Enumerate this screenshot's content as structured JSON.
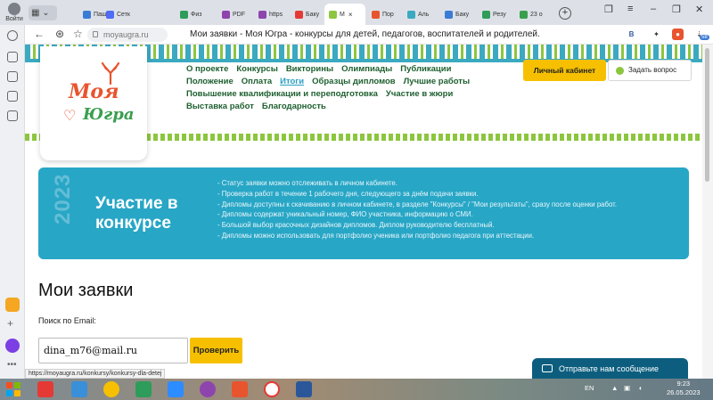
{
  "browser": {
    "profile_label": "Войти",
    "tabs": [
      {
        "label": "Паш",
        "color": "#3a7bd5"
      },
      {
        "label": "Сетк",
        "color": "#4e6cf5"
      },
      {
        "label": "Физ",
        "color": "#2e9c5a"
      },
      {
        "label": "PDF",
        "color": "#8e44ad"
      },
      {
        "label": "https",
        "color": "#8e44ad"
      },
      {
        "label": "Баку",
        "color": "#e53935"
      },
      {
        "label": "М",
        "color": "#8cc63f"
      },
      {
        "label": "Пор",
        "color": "#e8542e"
      },
      {
        "label": "Аль",
        "color": "#3ba9c0"
      },
      {
        "label": "Баку",
        "color": "#3a7bd5"
      },
      {
        "label": "Резу",
        "color": "#2e9c5a"
      },
      {
        "label": "23 о",
        "color": "#3a9e4f"
      }
    ],
    "active_tab_close": "×",
    "new_tab": "+",
    "address": "moyaugra.ru",
    "page_title": "Мои заявки - Моя Югра - конкурсы для детей, педагогов, воспитателей и родителей.",
    "status_url": "https://moyaugra.ru/konkursy/konkursy-dla-detej",
    "download_badge": "58"
  },
  "site": {
    "logo_line1": "Моя",
    "logo_line2": "Югра",
    "nav_rows": [
      [
        "О проекте",
        "Конкурсы",
        "Викторины",
        "Олимпиады",
        "Публикации"
      ],
      [
        "Положение",
        "Оплата",
        "Итоги",
        "Образцы дипломов",
        "Лучшие работы"
      ],
      [
        "Повышение квалификации и переподготовка",
        "Участие в жюри"
      ],
      [
        "Выставка работ",
        "Благодарность"
      ]
    ],
    "active_nav": "Итоги",
    "cabinet_button": "Личный кабинет",
    "ask_button": "Задать вопрос",
    "banner": {
      "year": "2023",
      "title": "Участие в конкурсе",
      "items": [
        "- Статус заявки можно отслеживать в личном кабинете.",
        "- Проверка работ в течение 1 рабочего дня, следующего за днём подачи заявки.",
        "- Дипломы доступны к скачиванию в личном кабинете, в разделе \"Конкурсы\" / \"Мои результаты\", сразу после оценки работ.",
        "- Дипломы содержат уникальный номер, ФИО участника, информацию о СМИ.",
        "- Большой выбор красочных дизайнов дипломов. Диплом руководителю бесплатный.",
        "- Дипломы можно использовать для портфолио ученика или портфолио педагога при аттестации."
      ]
    },
    "heading": "Мои заявки",
    "search_label": "Поиск по Email:",
    "email_value": "dina_m76@mail.ru",
    "check_button": "Проверить",
    "chat_widget": "Отправьте нам сообщение"
  },
  "taskbar": {
    "lang": "EN",
    "time": "9:23",
    "date": "26.05.2023"
  }
}
